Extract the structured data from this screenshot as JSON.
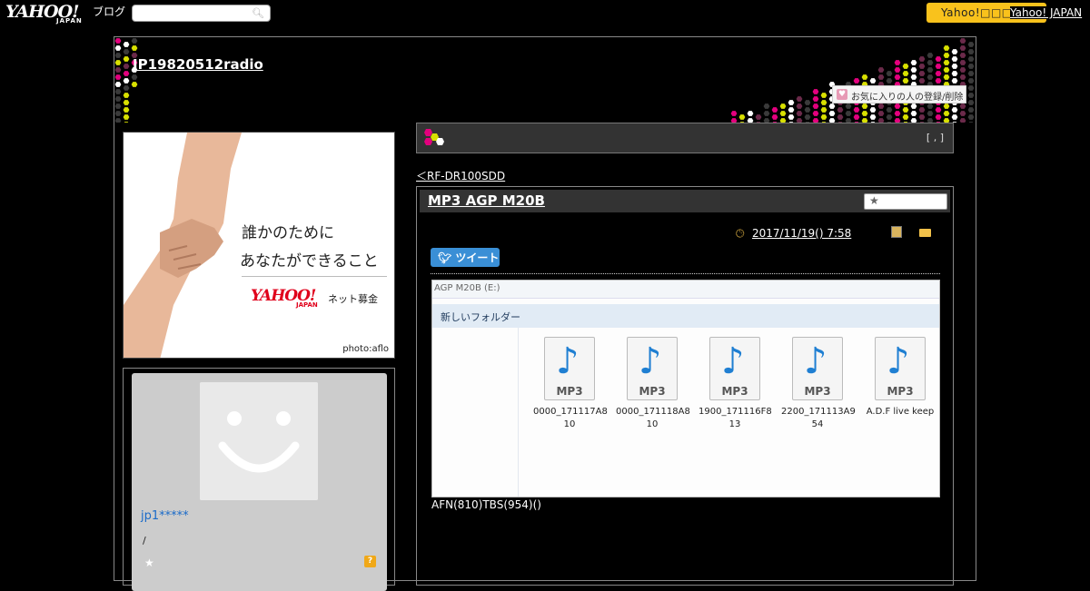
{
  "topbar": {
    "logo": "YAHOO!",
    "logo_sub": "JAPAN",
    "blog_label": "ブログ",
    "search_placeholder": "",
    "search_icon": "search-icon",
    "yahoo_button": "Yahoo!□□□□",
    "yahoo_japan_link": "Yahoo! JAPAN"
  },
  "blog": {
    "title": "JP19820512radio",
    "favorite_label": "お気に入りの人の登録/削除"
  },
  "ad": {
    "line1": "誰かのために",
    "line2": "あなたができること",
    "logo": "YAHOO!",
    "logo_sub": "JAPAN",
    "net_label": "ネット募金",
    "credit": "photo:aflo"
  },
  "profile": {
    "username": "jp1*****",
    "slash": "/",
    "help": "?"
  },
  "header_bar": {
    "brackets": "[ , ]"
  },
  "nav": {
    "prev_link": "＜RF-DR100SDD"
  },
  "article": {
    "title": "MP3 AGP M20B",
    "date": "2017/11/19()  7:58",
    "tweet_label": "ツイート",
    "caption": "AFN(810)TBS(954)()",
    "screenshot": {
      "address": "AGP M20B (E:)",
      "toolbar": "新しいフォルダー",
      "files": [
        {
          "name1": "0000_171117A8",
          "name2": "10"
        },
        {
          "name1": "0000_171118A8",
          "name2": "10"
        },
        {
          "name1": "1900_171116F8",
          "name2": "13"
        },
        {
          "name1": "2200_171113A9",
          "name2": "54"
        },
        {
          "name1": "A.D.F live keep",
          "name2": ""
        }
      ],
      "icon_label": "MP3"
    }
  },
  "colors": {
    "accent": "#f9c21c",
    "tweet": "#3a8fd6",
    "username": "#1a6bc9"
  }
}
